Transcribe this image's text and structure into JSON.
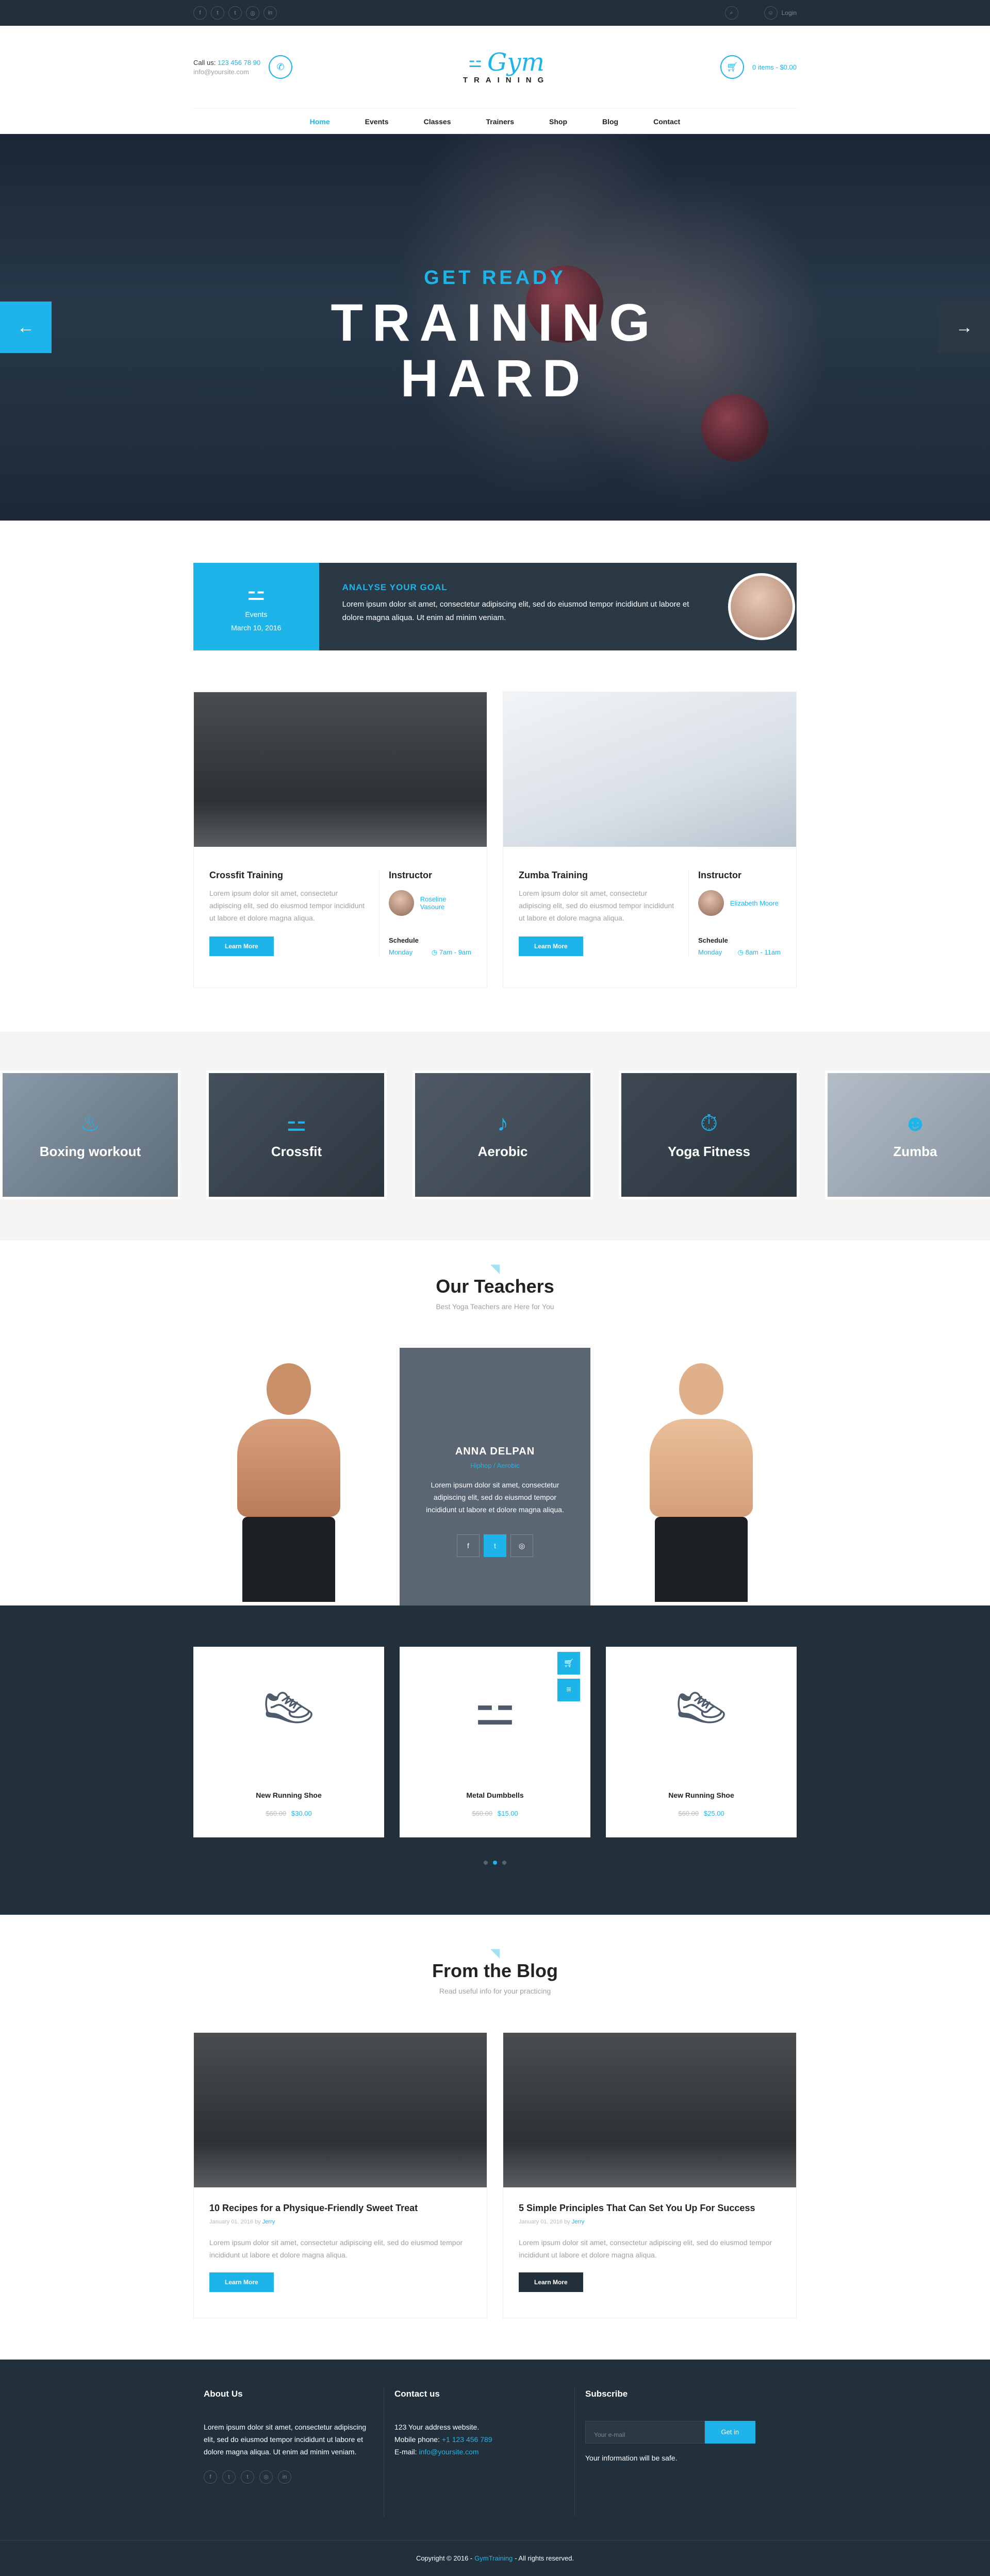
{
  "topbar": {
    "social": [
      {
        "icon": "facebook-icon",
        "glyph": "f"
      },
      {
        "icon": "twitter-icon",
        "glyph": "t"
      },
      {
        "icon": "tumblr-icon",
        "glyph": "t"
      },
      {
        "icon": "instagram-icon",
        "glyph": "◎"
      },
      {
        "icon": "linkedin-icon",
        "glyph": "in"
      }
    ],
    "login_label": "Login"
  },
  "header": {
    "call_label": "Call us:",
    "phone": "123 456 78 90",
    "email": "info@yoursite.com",
    "logo_top": "Gym",
    "logo_bottom": "TRAINING",
    "cart_text": "0 items - $0.00"
  },
  "nav": [
    "Home",
    "Events",
    "Classes",
    "Trainers",
    "Shop",
    "Blog",
    "Contact"
  ],
  "hero": {
    "kicker": "GET READY",
    "title_line1": "TRAINING",
    "title_line2": "HARD"
  },
  "event": {
    "label": "Events",
    "date": "March 10, 2016",
    "title": "ANALYSE YOUR GOAL",
    "text": "Lorem ipsum dolor sit amet, consectetur adipiscing elit, sed do eiusmod tempor incididunt ut labore et dolore magna aliqua. Ut enim ad minim veniam."
  },
  "classes": [
    {
      "title": "Crossfit Training",
      "text": "Lorem ipsum dolor sit amet, consectetur adipiscing elit, sed do eiusmod tempor incididunt ut labore et dolore magna aliqua.",
      "button": "Learn More",
      "instructor_label": "Instructor",
      "instructor": "Roseline Vasoure",
      "schedule_label": "Schedule",
      "day": "Monday",
      "time": "7am - 9am"
    },
    {
      "title": "Zumba Training",
      "text": "Lorem ipsum dolor sit amet, consectetur adipiscing elit, sed do eiusmod tempor incididunt ut labore et dolore magna aliqua.",
      "button": "Learn More",
      "instructor_label": "Instructor",
      "instructor": "Elizabeth Moore",
      "schedule_label": "Schedule",
      "day": "Monday",
      "time": "8am - 11am"
    }
  ],
  "categories": [
    "Boxing workout",
    "Crossfit",
    "Aerobic",
    "Yoga Fitness",
    "Zumba"
  ],
  "teachers": {
    "title": "Our Teachers",
    "subtitle": "Best Yoga Teachers are Here for You",
    "featured_name": "ANNA DELPAN",
    "featured_role": "Hiphop / Aerobic",
    "featured_text": "Lorem ipsum dolor sit amet, consectetur adipiscing elit, sed do eiusmod tempor incididunt ut labore et dolore magna aliqua."
  },
  "products": [
    {
      "name": "New Running Shoe",
      "old": "$60.00",
      "price": "$30.00"
    },
    {
      "name": "Metal Dumbbells",
      "old": "$60.00",
      "price": "$15.00"
    },
    {
      "name": "New Running Shoe",
      "old": "$60.00",
      "price": "$25.00"
    }
  ],
  "blog": {
    "title": "From the Blog",
    "subtitle": "Read useful info for your practicing",
    "posts": [
      {
        "title": "10 Recipes for a Physique-Friendly Sweet Treat",
        "date": "January 01, 2016 by",
        "author": "Jerry",
        "text": "Lorem ipsum dolor sit amet, consectetur adipiscing elit, sed do eiusmod tempor incididunt ut labore et dolore magna aliqua.",
        "button": "Learn More"
      },
      {
        "title": "5 Simple Principles That Can Set You Up For Success",
        "date": "January 01, 2016 by",
        "author": "Jerry",
        "text": "Lorem ipsum dolor sit amet, consectetur adipiscing elit, sed do eiusmod tempor incididunt ut labore et dolore magna aliqua.",
        "button": "Learn More"
      }
    ]
  },
  "footer": {
    "about_title": "About Us",
    "about_text": "Lorem ipsum dolor sit amet, consectetur adipiscing elit, sed do eiusmod tempor incididunt ut labore et dolore magna aliqua. Ut enim ad minim veniam.",
    "contact_title": "Contact us",
    "address": "123 Your address website.",
    "mobile_label": "Mobile phone:",
    "mobile": "+1 123 456 789",
    "email_label": "E-mail:",
    "email": "info@yoursite.com",
    "subscribe_title": "Subscribe",
    "subscribe_placeholder": "Your e-mail",
    "subscribe_button": "Get in",
    "safe_text": "Your information will be safe.",
    "copyright_pre": "Copyright © 2016 -",
    "copyright_brand": "GymTraining",
    "copyright_post": "- All rights reserved."
  },
  "colors": {
    "accent": "#1eb4ea",
    "dark": "#22303b"
  }
}
